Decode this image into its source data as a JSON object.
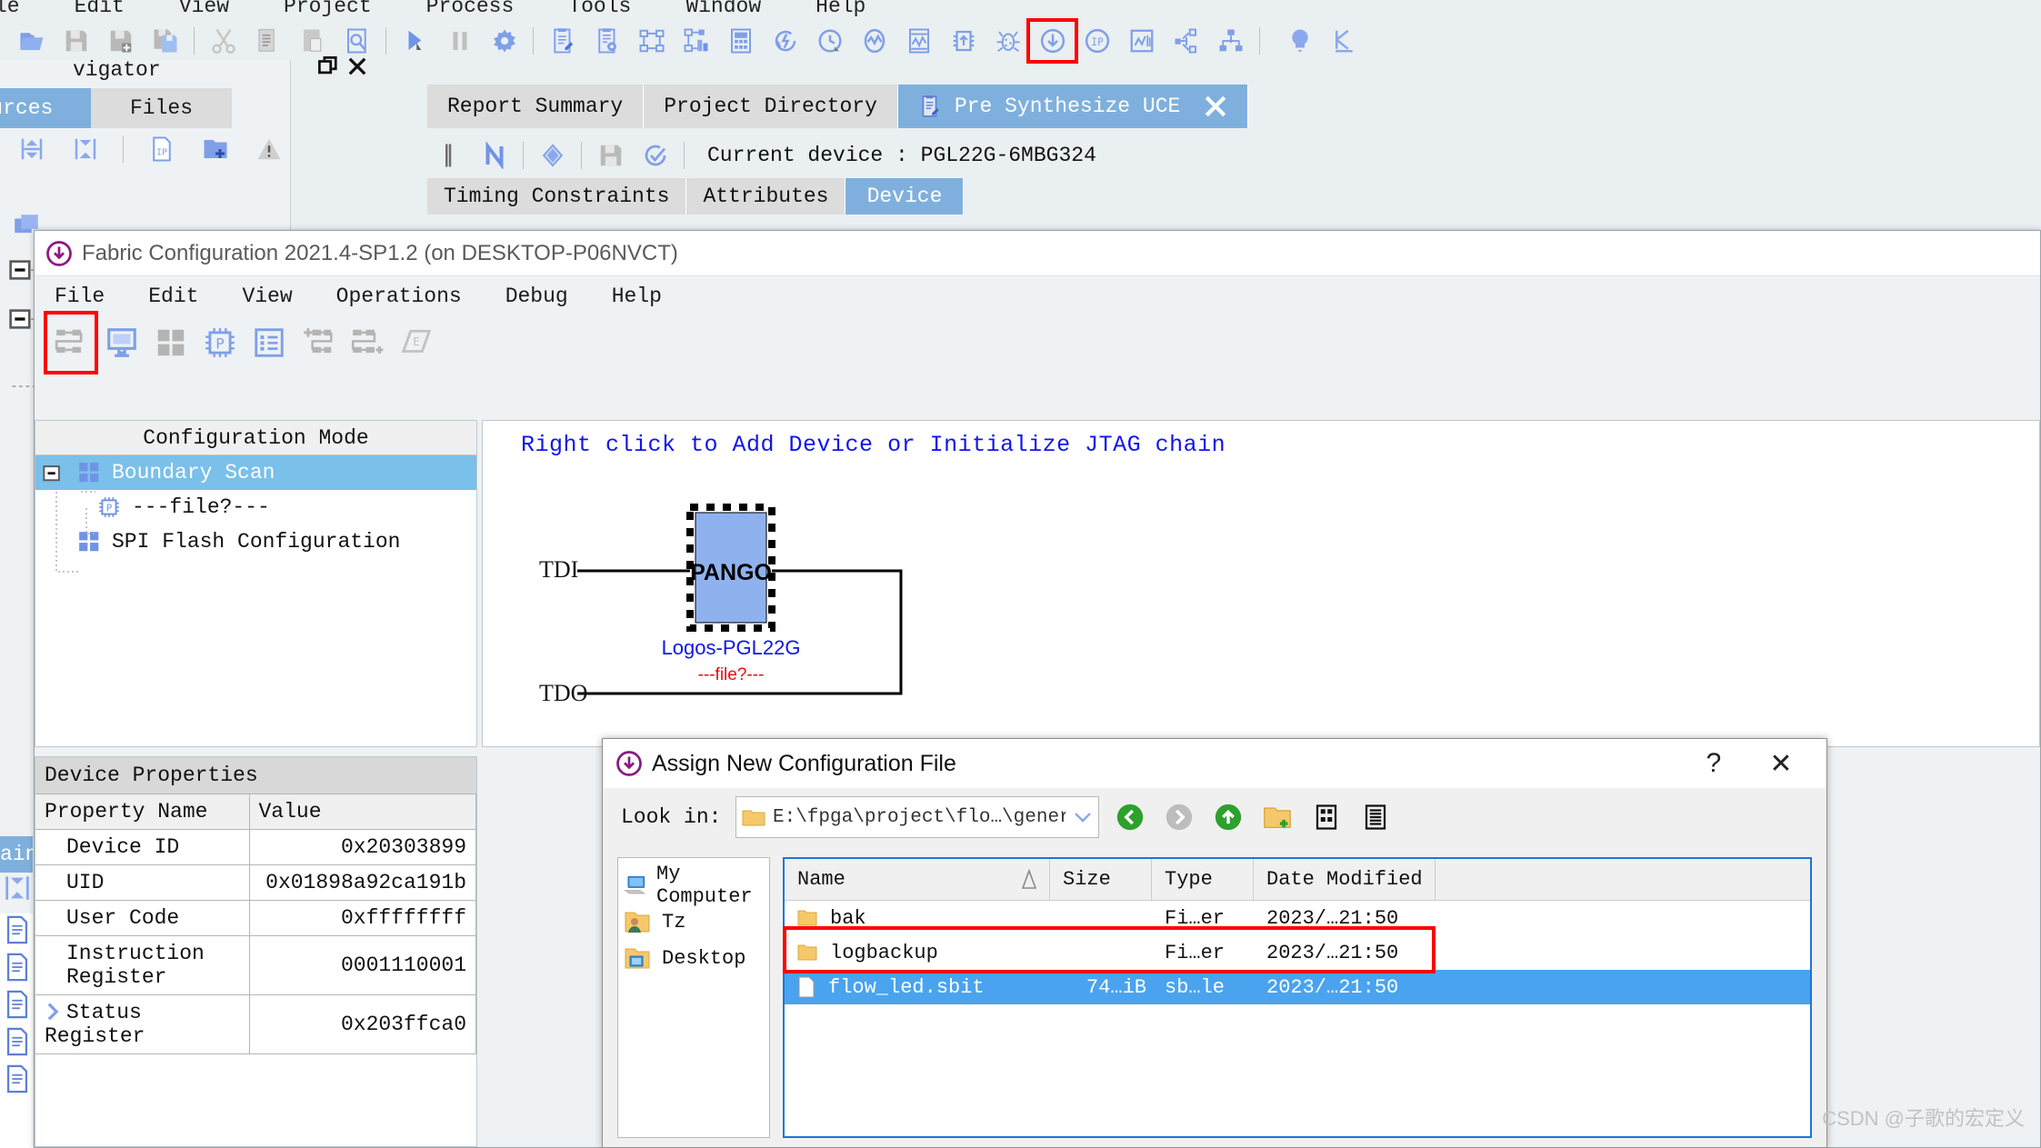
{
  "ide": {
    "menubar": [
      "le",
      "Edit",
      "View",
      "Project",
      "Process",
      "Tools",
      "Window",
      "Help"
    ],
    "toolbar_icons": [
      "open-project-icon",
      "save-icon",
      "save-as-icon",
      "save-all-icon",
      "cut-icon",
      "copy-icon",
      "paste-icon",
      "find-icon",
      "run-icon",
      "pause-icon",
      "settings-icon",
      "report-icon",
      "report-settings-icon",
      "rtl-view-icon",
      "netlist-view-icon",
      "resource-calc-icon",
      "refresh-synth-icon",
      "timing-icon",
      "power-icon",
      "waveform-icon",
      "io-planner-icon",
      "debug-bug-icon",
      "download-icon",
      "ip-compiler-icon",
      "chart-icon",
      "graph-icon",
      "hierarchy-icon",
      "tips-icon",
      "k-logo-icon"
    ],
    "navigator": {
      "title": "vigator",
      "float_icon": "restore-icon",
      "close_icon": "close-icon",
      "tabs": [
        {
          "label": "Sources",
          "active": true
        },
        {
          "label": "Files",
          "active": false
        }
      ],
      "tool_icons": [
        "expand-all-icon",
        "collapse-all-icon",
        "ip-file-icon",
        "add-folder-icon",
        "warning-icon"
      ]
    },
    "doc_tabs": [
      {
        "label": "Report Summary",
        "active": false,
        "icon": ""
      },
      {
        "label": "Project Directory",
        "active": false,
        "icon": ""
      },
      {
        "label": "Pre Synthesize UCE",
        "active": true,
        "icon": "report-icon",
        "close_icon": "close-icon"
      }
    ],
    "doc_toolbar_icons": [
      "pause-bars-icon",
      "netlist-n-icon",
      "diamond-icon",
      "save-icon",
      "check-circle-icon"
    ],
    "current_device_label": "Current device : PGL22G-6MBG324",
    "sub_tabs": [
      {
        "label": "Timing Constraints",
        "active": false
      },
      {
        "label": "Attributes",
        "active": false
      },
      {
        "label": "Device",
        "active": true
      }
    ],
    "left_strip_label": "ain"
  },
  "fabric": {
    "title": "Fabric Configuration 2021.4-SP1.2 (on DESKTOP-P06NVCT)",
    "title_icon": "download-circle-icon",
    "menubar": [
      "File",
      "Edit",
      "View",
      "Operations",
      "Debug",
      "Help"
    ],
    "toolbar_icons": [
      "detect-chain-icon",
      "monitor-icon",
      "grid-icon",
      "chip-p-icon",
      "list-icon",
      "add-device-icon",
      "add-device-right-icon",
      "erase-icon"
    ],
    "toolbar_highlight_index": 0,
    "config_mode": {
      "header": "Configuration Mode",
      "tree": [
        {
          "label": "Boundary Scan",
          "icon": "grid-blue-icon",
          "selected": true,
          "expander": "minus",
          "indent": 0
        },
        {
          "label": "---file?---",
          "icon": "chip-p-icon",
          "selected": false,
          "expander": "none",
          "indent": 1
        },
        {
          "label": "SPI Flash Configuration",
          "icon": "grid-blue-icon",
          "selected": false,
          "expander": "none",
          "indent": 0
        }
      ]
    },
    "schematic": {
      "hint": "Right click to Add Device or Initialize JTAG chain",
      "chip_label": "PANGO",
      "device_label": "Logos-PGL22G",
      "file_label": "---file?---",
      "tdi_label": "TDI",
      "tdo_label": "TDO"
    },
    "device_properties": {
      "panel_title": "Device Properties",
      "columns": [
        "Property Name",
        "Value"
      ],
      "rows": [
        {
          "name": "Device ID",
          "value": "0x20303899",
          "expander": false
        },
        {
          "name": "UID",
          "value": "0x01898a92ca191b",
          "expander": false
        },
        {
          "name": "User Code",
          "value": "0xffffffff",
          "expander": false
        },
        {
          "name": "Instruction Register",
          "value": "0001110001",
          "expander": false
        },
        {
          "name": "Status Register",
          "value": "0x203ffca0",
          "expander": true
        }
      ]
    }
  },
  "dialog": {
    "title": "Assign New Configuration File",
    "title_icon": "download-circle-icon",
    "help_label": "?",
    "close_label": "✕",
    "lookin_label": "Look in:",
    "lookin_value": "E:\\fpga\\project\\flo…\\generate_bitstream",
    "lookin_folder_icon": "folder-icon",
    "lookin_dropdown_icon": "chevron-down-icon",
    "nav_icons": [
      "back-icon",
      "forward-icon",
      "parent-dir-icon",
      "new-folder-icon",
      "list-view-icon",
      "detail-view-icon"
    ],
    "places": [
      {
        "label": "My Computer",
        "icon": "computer-icon"
      },
      {
        "label": "Tz",
        "icon": "user-folder-icon"
      },
      {
        "label": "Desktop",
        "icon": "desktop-folder-icon"
      }
    ],
    "columns": [
      {
        "label": "Name",
        "sort": "ascending"
      },
      {
        "label": "Size",
        "sort": ""
      },
      {
        "label": "Type",
        "sort": ""
      },
      {
        "label": "Date Modified",
        "sort": ""
      }
    ],
    "files": [
      {
        "name": "bak",
        "size": "",
        "type": "Fi…er",
        "date": "2023/…21:50",
        "icon": "folder-icon",
        "selected": false
      },
      {
        "name": "logbackup",
        "size": "",
        "type": "Fi…er",
        "date": "2023/…21:50",
        "icon": "folder-icon",
        "selected": false
      },
      {
        "name": "flow_led.sbit",
        "size": "74…iB",
        "type": "sb…le",
        "date": "2023/…21:50",
        "icon": "file-icon",
        "selected": true
      }
    ],
    "highlight_row_index": 2
  },
  "watermark": "CSDN @子歌的宏定义",
  "colors": {
    "accent_blue": "#4aa3ef",
    "tab_blue": "#7fb0dd",
    "highlight_red": "#ff0000",
    "hint_blue": "#1116e8",
    "file_red": "#e01010",
    "icon_blue": "#8ba8ee",
    "purple": "#8c1a83"
  }
}
